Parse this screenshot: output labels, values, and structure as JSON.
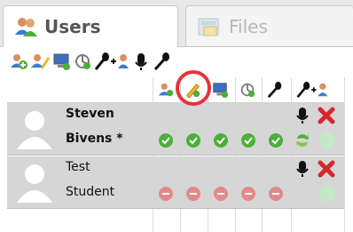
{
  "tabs": [
    {
      "label": "Users",
      "active": true,
      "icon": "users-icon"
    },
    {
      "label": "Files",
      "active": false,
      "icon": "files-icon"
    }
  ],
  "toolbar": {
    "icons": [
      "add-user-icon",
      "edit-user-icon",
      "computer-icon",
      "settings-icon",
      "microphone-icon",
      "add-microphone-user-icon",
      "microphone-off-icon",
      "microphone-on-icon"
    ]
  },
  "table": {
    "header_icons": [
      "user-icon",
      "edit-icon",
      "computer-icon",
      "settings-icon",
      "microphone-icon",
      "add-microphone-user-icon"
    ],
    "rows": [
      {
        "first_name": "Steven",
        "last_name": "Bivens *",
        "bold": true,
        "status": [
          "check",
          "check",
          "check",
          "check",
          "check"
        ],
        "extra": [
          "refresh",
          "circle"
        ],
        "actions": [
          "microphone",
          "delete"
        ]
      },
      {
        "first_name": "Test",
        "last_name": "Student",
        "bold": false,
        "status": [
          "minus",
          "minus",
          "minus",
          "minus",
          "minus"
        ],
        "extra": [
          "circle"
        ],
        "actions": [
          "microphone",
          "delete"
        ]
      }
    ]
  },
  "colors": {
    "check": "#4caf3a",
    "minus": "#e28a8a",
    "delete": "#d9262b",
    "highlight": "#e8323a"
  }
}
